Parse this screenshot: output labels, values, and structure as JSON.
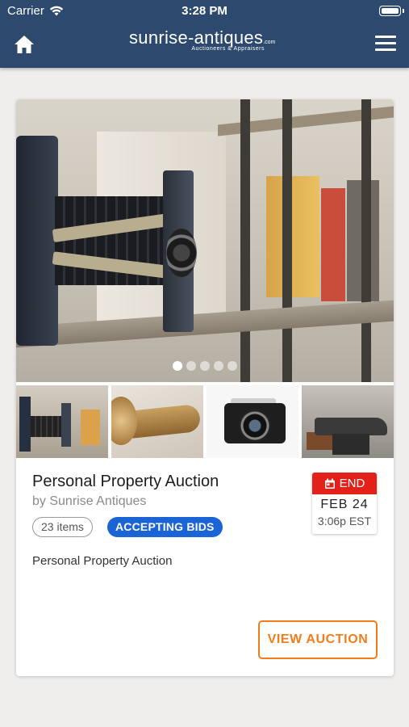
{
  "status_bar": {
    "carrier": "Carrier",
    "time": "3:28 PM",
    "icons": [
      "wifi-icon",
      "battery-icon"
    ]
  },
  "header": {
    "logo_name": "sunrise-antiques",
    "logo_suffix": ".com",
    "logo_tagline": "Auctioneers & Appraisers",
    "left_icon": "home-icon",
    "right_icon": "menu-icon",
    "background_color": "#2d4a6e"
  },
  "carousel": {
    "slide_count": 5,
    "active_index": 0,
    "thumbnails": [
      "folding camera",
      "brass horn",
      "film camera",
      "anvil"
    ]
  },
  "auction": {
    "title": "Personal Property Auction",
    "seller": "by Sunrise Antiques",
    "items_count_label": "23 items",
    "status_label": "ACCEPTING BIDS",
    "status_color": "#1a64d6",
    "end_label": "END",
    "end_color": "#e32119",
    "end_date": "FEB 24",
    "end_time": "3:06p EST",
    "description": "Personal Property Auction",
    "view_button_label": "VIEW AUCTION",
    "accent_color": "#f07d1a"
  }
}
